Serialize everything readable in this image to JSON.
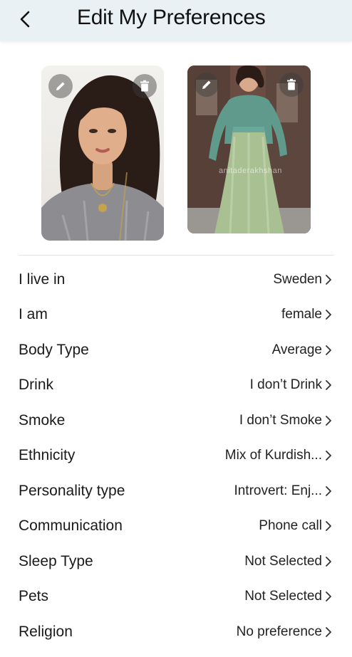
{
  "header": {
    "title": "Edit My Preferences"
  },
  "photos": [
    {
      "edit_icon": "pencil-icon",
      "delete_icon": "trash-icon"
    },
    {
      "edit_icon": "pencil-icon",
      "delete_icon": "trash-icon",
      "watermark": "anitaderakhshan"
    }
  ],
  "preferences": [
    {
      "label": "I live in",
      "value": "Sweden"
    },
    {
      "label": "I am",
      "value": "female"
    },
    {
      "label": "Body Type",
      "value": "Average"
    },
    {
      "label": "Drink",
      "value": "I don’t Drink"
    },
    {
      "label": "Smoke",
      "value": "I don’t Smoke"
    },
    {
      "label": "Ethnicity",
      "value": "Mix of Kurdish..."
    },
    {
      "label": "Personality type",
      "value": "Introvert: Enj..."
    },
    {
      "label": "Communication",
      "value": "Phone call"
    },
    {
      "label": "Sleep Type",
      "value": "Not Selected"
    },
    {
      "label": "Pets",
      "value": "Not Selected"
    },
    {
      "label": "Religion",
      "value": "No preference"
    }
  ],
  "colors": {
    "header_bg": "#eaf1f4",
    "text": "#1a1a1a",
    "divider": "#e3e3e3"
  }
}
